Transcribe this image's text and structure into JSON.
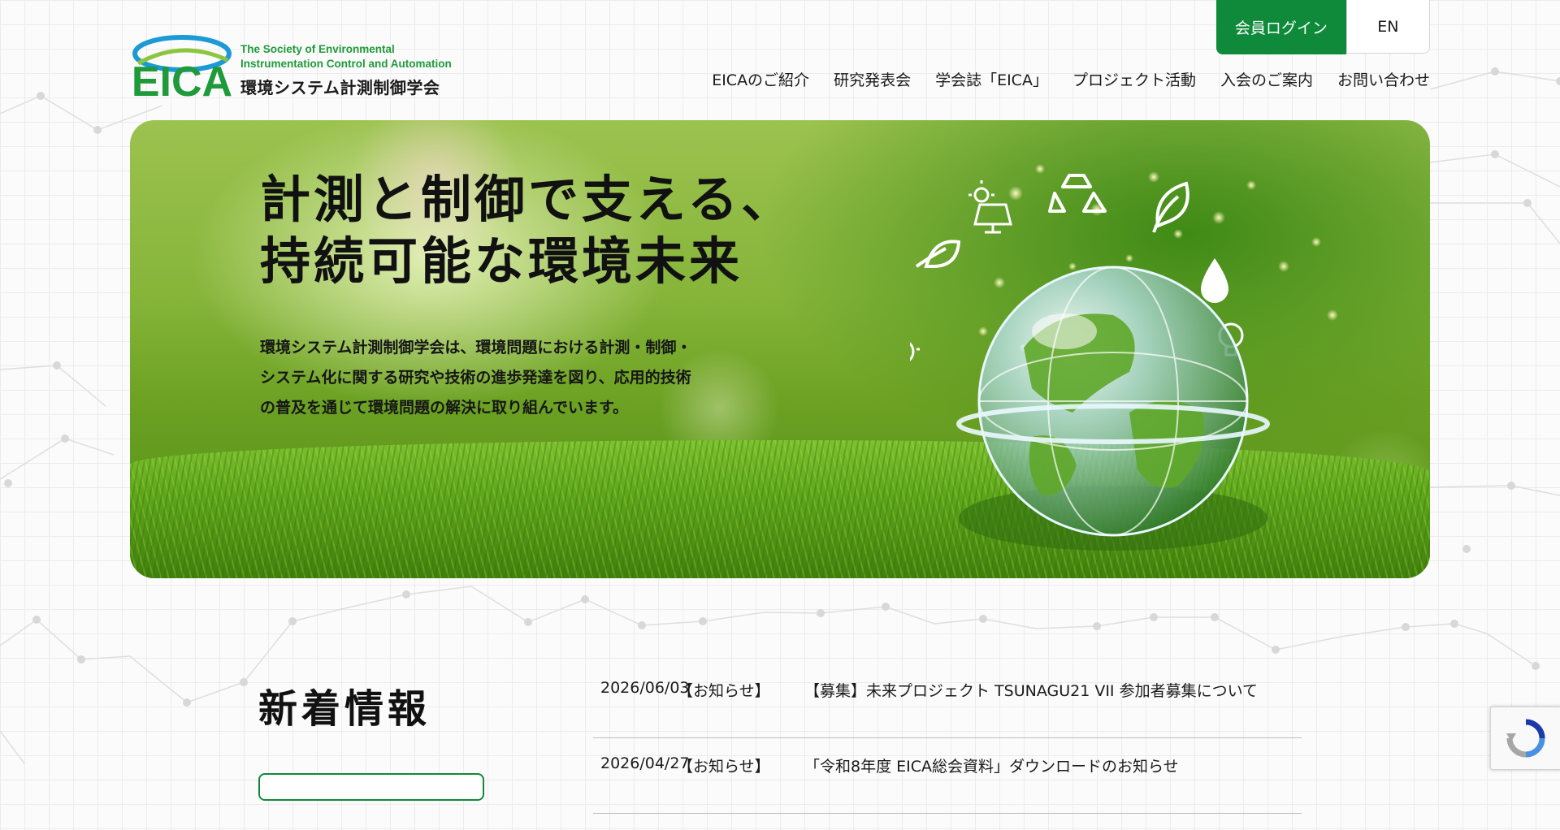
{
  "header": {
    "logo_mark": "EICA",
    "logo_en_line1": "The Society of Environmental",
    "logo_en_line2": "Instrumentation Control and Automation",
    "logo_jp": "環境システム計測制御学会",
    "login_label": "会員ログイン",
    "lang_label": "EN"
  },
  "nav": {
    "items": [
      {
        "label": "EICAのご紹介"
      },
      {
        "label": "研究発表会"
      },
      {
        "label": "学会誌「EICA」"
      },
      {
        "label": "プロジェクト活動"
      },
      {
        "label": "入会のご案内"
      },
      {
        "label": "お問い合わせ"
      }
    ]
  },
  "hero": {
    "title_line1": "計測と制御で支える、",
    "title_line2": "持続可能な環境未来",
    "desc_line1": "環境システム計測制御学会は、環境問題における計測・制御・",
    "desc_line2": "システム化に関する研究や技術の進歩発達を図り、応用的技術",
    "desc_line3": "の普及を通じて環境問題の解決に取り組んでいます。"
  },
  "news": {
    "heading": "新着情報",
    "items": [
      {
        "date": "2026/06/03",
        "category": "【お知らせ】",
        "title": "【募集】未来プロジェクト TSUNAGU21 VII 参加者募集について"
      },
      {
        "date": "2026/04/27",
        "category": "【お知らせ】",
        "title": "「令和8年度 EICA総会資料」ダウンロードのお知らせ"
      }
    ]
  },
  "colors": {
    "brand_green": "#0e8a3a",
    "logo_green": "#1f9a3a",
    "text": "#1a1a1a"
  },
  "icons": [
    "eica-logo-mark",
    "solar-panel-icon",
    "recycle-icon",
    "leaf-icon",
    "water-drop-icon",
    "lightbulb-icon",
    "eco-bulb-icon",
    "globe-illustration",
    "recaptcha-icon"
  ]
}
